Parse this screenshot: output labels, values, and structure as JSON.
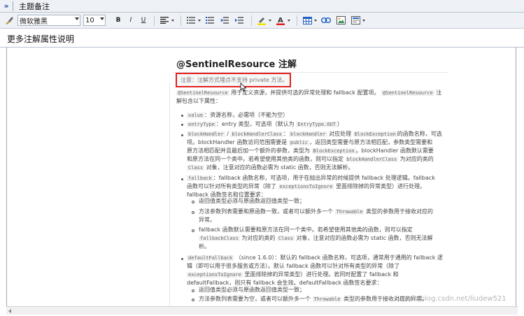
{
  "window": {
    "title": "主题备注"
  },
  "toolbar": {
    "font_name": "微软雅黑",
    "font_size": "10",
    "bold": "B",
    "italic": "I",
    "underline": "U",
    "color_a": "A"
  },
  "section": {
    "title": "更多注解属性说明"
  },
  "doc": {
    "heading": "@SentinelResource 注解",
    "note": "注意：注解方式埋点不支持 private 方法。",
    "intro_code_1": "@SentinelResource",
    "intro_text_1": "用于定义资源，并提供可选的异常处理和 fallback 配置项。",
    "intro_code_2": "@SentinelResource",
    "intro_text_2": "注",
    "intro_line2": "解包含以下属性：",
    "b1_code": "value",
    "b1_text": "：资源名称，必需项（不能为空）",
    "b2_code": "entryType",
    "b2_text": "：entry 类型，可选项（默认为",
    "b2_code2": "EntryType.OUT",
    "b2_end": "）",
    "b3_code": "blockHandler",
    "b3_slash": "/",
    "b3_code2": "blockHandlerClass",
    "b3_colon": "：",
    "b3_code3": "blockHandler",
    "b3_text1": "对应处理",
    "b3_code4": "BlockException",
    "b3_text2": "的函数名称，可选",
    "b3_l2a": "项。blockHandler 函数访问范围需要是",
    "b3_l2code": "public",
    "b3_l2b": "，返回类型需要与原方法相匹配，参数类型需要和",
    "b3_l3a": "原方法相匹配并且最后加一个额外的参数，类型为",
    "b3_l3code": "BlockException",
    "b3_l3b": "。blockHandler 函数默认需要",
    "b3_l4a": "和原方法在同一个类中。若希望使用其他类的函数，则可以指定",
    "b3_l4code": "blockHandlerClass",
    "b3_l4b": "为对应的类的",
    "b3_l5code": "Class",
    "b3_l5b": "对象，注意对应的函数必需为 static 函数，否则无法解析。",
    "b4_code": "fallback",
    "b4_text": "：fallback 函数名称，可选项，用于在抛出异常的时候提供 fallback 处理逻辑。fallback",
    "b4_l2a": "函数可以针对所有类型的异常（除了",
    "b4_l2code": "exceptionsToIgnore",
    "b4_l2b": "里面排除掉的异常类型）进行处理。",
    "b4_l3": "fallback 函数签名和位置要求：",
    "s1": "返回值类型必须与原函数返回值类型一致；",
    "s2a": "方法参数列表需要和原函数一致，或者可以额外多一个",
    "s2code": "Throwable",
    "s2b": "类型的参数用于接收对应的",
    "s2c": "异常。",
    "s3a": "fallback 函数默认需要和原方法在同一个类中。若希望使用其他类的函数，则可以指定",
    "s3code": "fallbackClass",
    "s3b": "为对应的类的",
    "s3code2": "Class",
    "s3c": "对象，注意对应的函数必需为 static 函数，否则无法解",
    "s3d": "析。",
    "b5_code": "defaultFallback",
    "b5_text": "（since 1.6.0）：默认的 fallback 函数名称，可选项，通常用于通用的 fallback 逻",
    "b5_l2": "辑（即可以用于很多服务或方法）。默认 fallback 函数可以针对所有类型的异常（除了",
    "b5_l3code": "exceptionsToIgnore",
    "b5_l3b": "里面排除掉的异常类型）进行处理。若同时配置了 fallback 和",
    "b5_l4": "defaultFallback，则只有 fallback 会生效。defaultFallback 函数签名要求：",
    "t1": "返回值类型必须与原函数返回值类型一致；",
    "t2a": "方法参数列表需要为空，或者可以额外多一个",
    "t2code": "Throwable",
    "t2b": "类型的参数用于接收对应的异常。"
  },
  "watermark": "https://blog.csdn.net/liudew521"
}
